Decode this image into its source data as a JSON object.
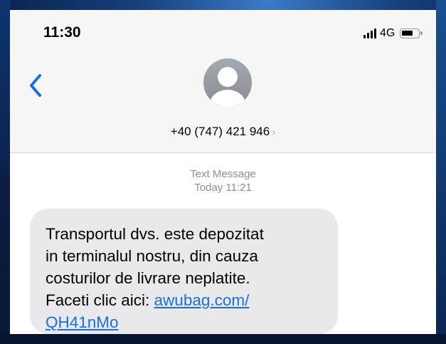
{
  "status_bar": {
    "time": "11:30",
    "network": "4G",
    "signal_icon": "signal-bars-icon",
    "battery_icon": "battery-icon"
  },
  "header": {
    "back_icon": "chevron-left-icon",
    "avatar_icon": "person-placeholder-icon",
    "contact": "+40 (747) 421 946",
    "contact_chevron": "›"
  },
  "conversation": {
    "kind_label": "Text Message",
    "timestamp": "Today 11:21"
  },
  "message": {
    "line1": "Transportul dvs. este depozitat",
    "line2": "in terminalul nostru, din cauza",
    "line3": "costurilor de livrare neplatite.",
    "line4_text": "Faceti clic aici: ",
    "link_part1": "awubag.com/",
    "link_part2": "QH41nMo"
  },
  "colors": {
    "accent": "#1a6fe0",
    "bubble": "#e9e9eb",
    "header_bg": "#f6f6f7",
    "meta_text": "#8e8e93"
  }
}
